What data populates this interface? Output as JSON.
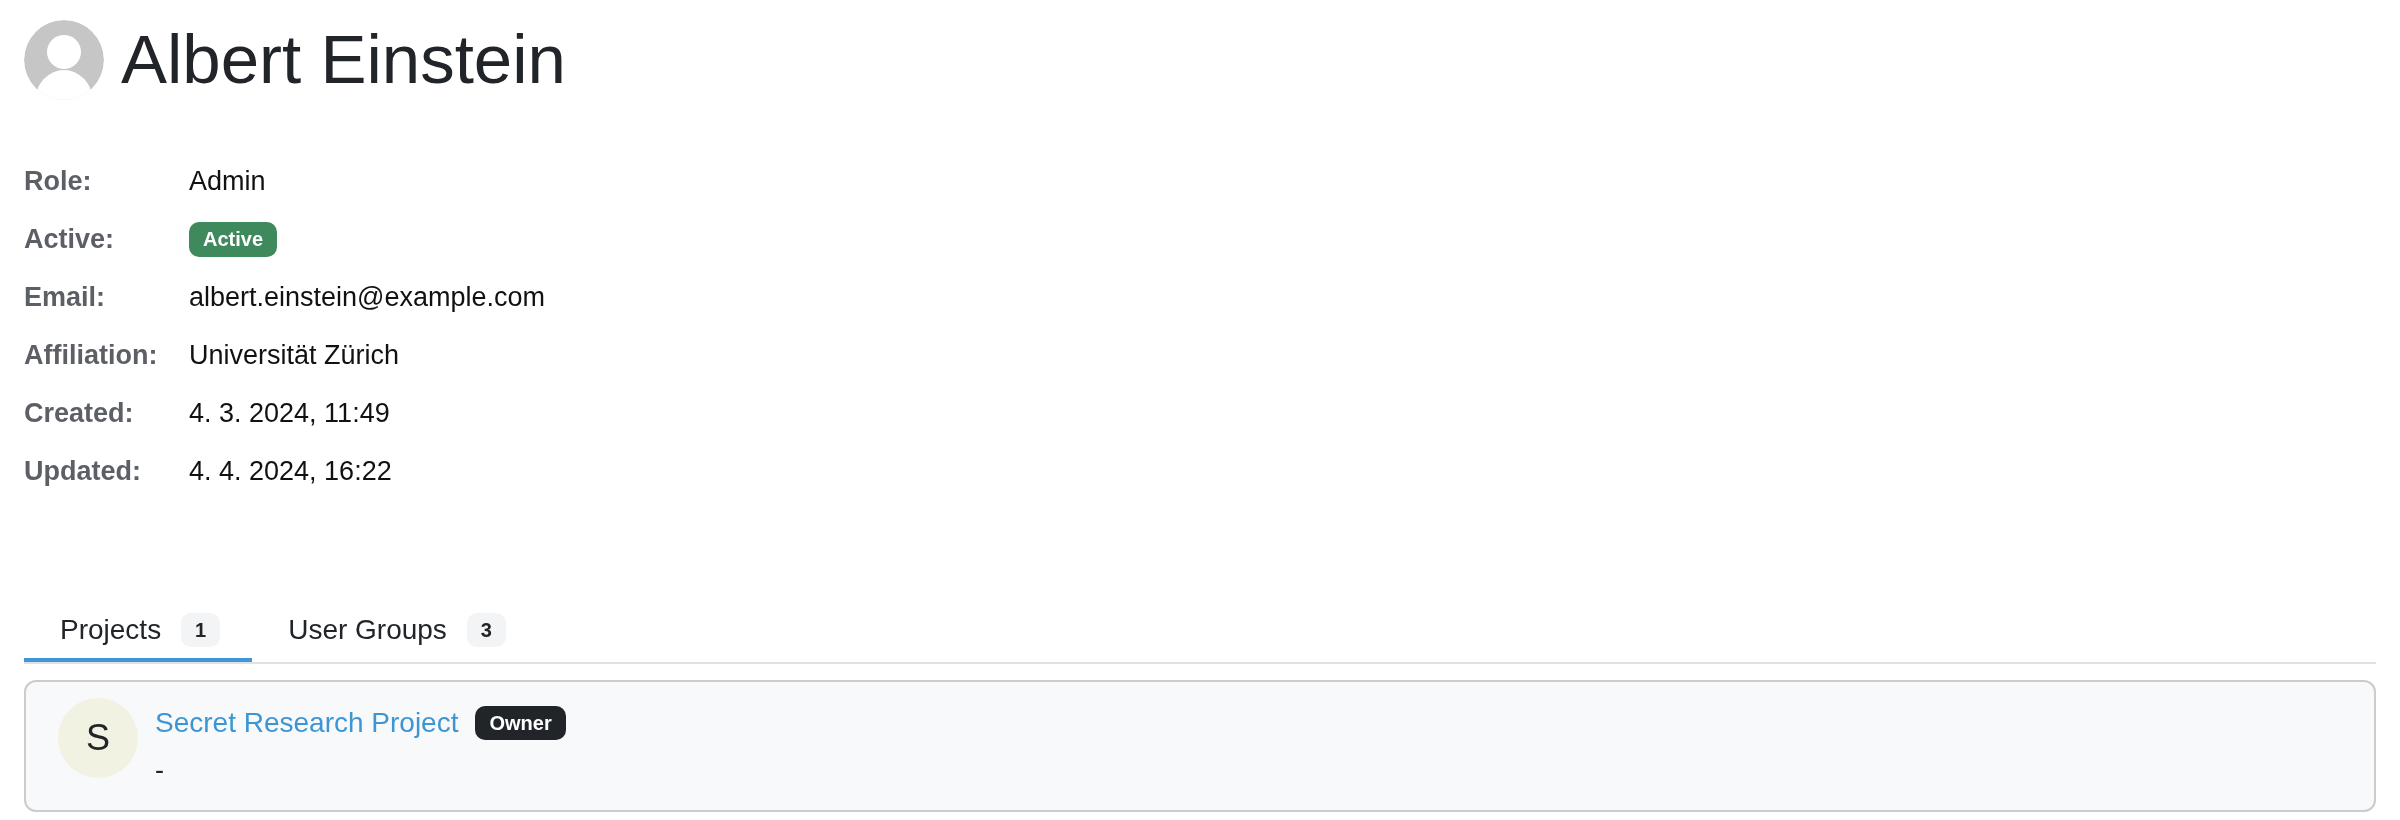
{
  "user": {
    "name": "Albert Einstein"
  },
  "details": [
    {
      "label": "Role:",
      "kind": "text",
      "value": "Admin"
    },
    {
      "label": "Active:",
      "kind": "badge",
      "value": "Active"
    },
    {
      "label": "Email:",
      "kind": "text",
      "value": "albert.einstein@example.com"
    },
    {
      "label": "Affiliation:",
      "kind": "text",
      "value": "Universität Zürich"
    },
    {
      "label": "Created:",
      "kind": "text",
      "value": "4. 3. 2024, 11:49"
    },
    {
      "label": "Updated:",
      "kind": "text",
      "value": "4. 4. 2024, 16:22"
    }
  ],
  "tabs": [
    {
      "label": "Projects",
      "count": "1",
      "selected": true
    },
    {
      "label": "User Groups",
      "count": "3",
      "selected": false
    }
  ],
  "projects": [
    {
      "initial": "S",
      "name": "Secret Research Project",
      "role": "Owner",
      "description": "-"
    }
  ]
}
